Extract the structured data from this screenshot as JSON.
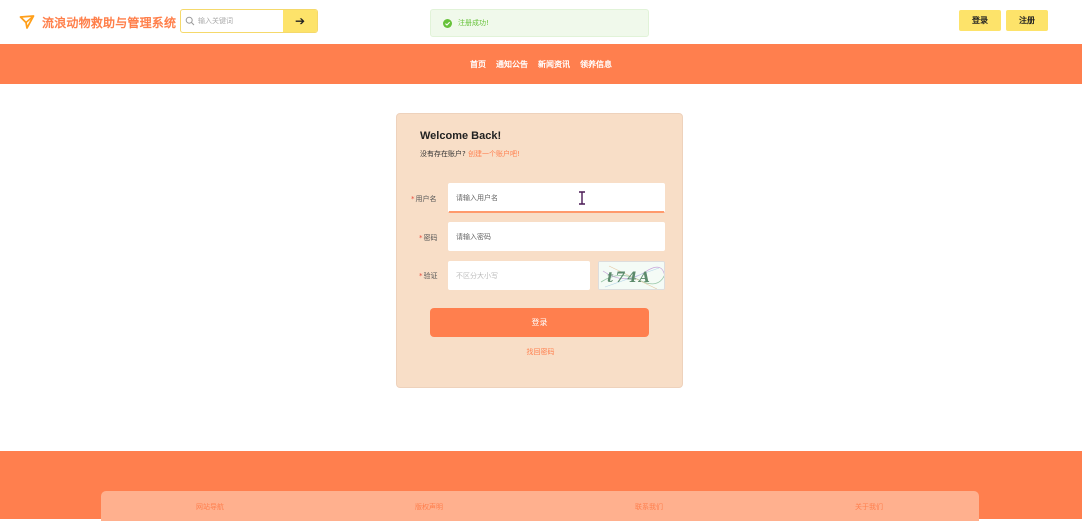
{
  "header": {
    "site_title": "流浪动物救助与管理系统",
    "search": {
      "placeholder": "输入关键词",
      "submit_glyph": "➔"
    },
    "toast": "注册成功!",
    "login_label": "登录",
    "register_label": "注册"
  },
  "nav": {
    "items": [
      "首页",
      "通知公告",
      "新闻资讯",
      "领养信息"
    ]
  },
  "login_form": {
    "title": "Welcome Back!",
    "no_account_text": "没有存在账户?",
    "create_account_link": "创建一个账户吧!",
    "username": {
      "label": "用户名",
      "placeholder": "请输入用户名"
    },
    "password": {
      "label": "密码",
      "placeholder": "请输入密码"
    },
    "captcha": {
      "label": "验证",
      "placeholder": "不区分大小写",
      "image_text": "t74A"
    },
    "required_mark": "*",
    "submit_label": "登录",
    "forgot_link": "找回密码"
  },
  "footer": {
    "links": [
      "网站导航",
      "版权声明",
      "联系我们",
      "关于我们"
    ]
  },
  "colors": {
    "primary": "#ff7f4e",
    "accent_yellow": "#fde36a",
    "card_bg": "#f8dec7",
    "success": "#67c23a"
  }
}
